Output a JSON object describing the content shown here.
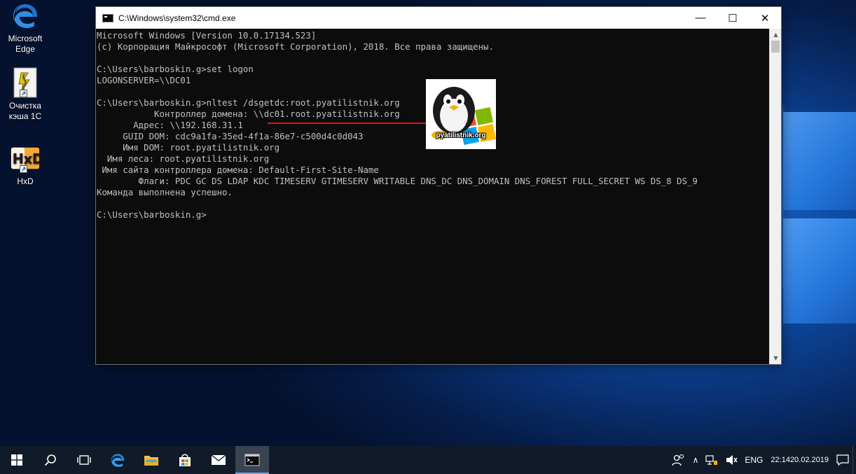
{
  "desktop": {
    "icons": [
      {
        "label": "Microsoft Edge",
        "icon": "edge-icon"
      },
      {
        "label": "Очистка кэша 1С",
        "icon": "batch-file-icon"
      },
      {
        "label": "HxD",
        "icon": "hxd-icon"
      }
    ]
  },
  "window": {
    "title": "C:\\Windows\\system32\\cmd.exe",
    "minimize_glyph": "—",
    "maximize_glyph": "☐",
    "close_glyph": "✕"
  },
  "console": {
    "lines": [
      "Microsoft Windows [Version 10.0.17134.523]",
      "(c) Корпорация Майкрософт (Microsoft Corporation), 2018. Все права защищены.",
      "",
      "C:\\Users\\barboskin.g>set logon",
      "LOGONSERVER=\\\\DC01",
      "",
      "C:\\Users\\barboskin.g>nltest /dsgetdc:root.pyatilistnik.org",
      "           Контроллер домена: \\\\dc01.root.pyatilistnik.org",
      "       Адрес: \\\\192.168.31.1",
      "     GUID DOM: cdc9a1fa-35ed-4f1a-86e7-c500d4c0d043",
      "     Имя DOM: root.pyatilistnik.org",
      "  Имя леса: root.pyatilistnik.org",
      " Имя сайта контроллера домена: Default-First-Site-Name",
      "        Флаги: PDC GC DS LDAP KDC TIMESERV GTIMESERV WRITABLE DNS_DC DNS_DOMAIN DNS_FOREST FULL_SECRET WS DS_8 DS_9",
      "Команда выполнена успешно.",
      "",
      "C:\\Users\\barboskin.g>"
    ]
  },
  "overlay": {
    "logo_text": "pyatilistnik.org"
  },
  "taskbar": {
    "buttons": [
      {
        "name": "start-button",
        "icon": "windows-logo-icon"
      },
      {
        "name": "search-button",
        "icon": "search-icon"
      },
      {
        "name": "task-view-button",
        "icon": "task-view-icon"
      },
      {
        "name": "taskbar-edge",
        "icon": "edge-icon"
      },
      {
        "name": "taskbar-file-explorer",
        "icon": "folder-icon"
      },
      {
        "name": "taskbar-store",
        "icon": "store-icon"
      },
      {
        "name": "taskbar-mail",
        "icon": "mail-icon"
      },
      {
        "name": "taskbar-cmd",
        "icon": "cmd-icon",
        "active": true
      }
    ],
    "tray": {
      "language": "ENG",
      "time": "22:14",
      "date": "20.02.2019"
    }
  },
  "colors": {
    "console_bg": "#0c0c0c",
    "console_text": "#c0c0c0",
    "underline": "#e3141c",
    "taskbar_bg": "#101a28"
  }
}
